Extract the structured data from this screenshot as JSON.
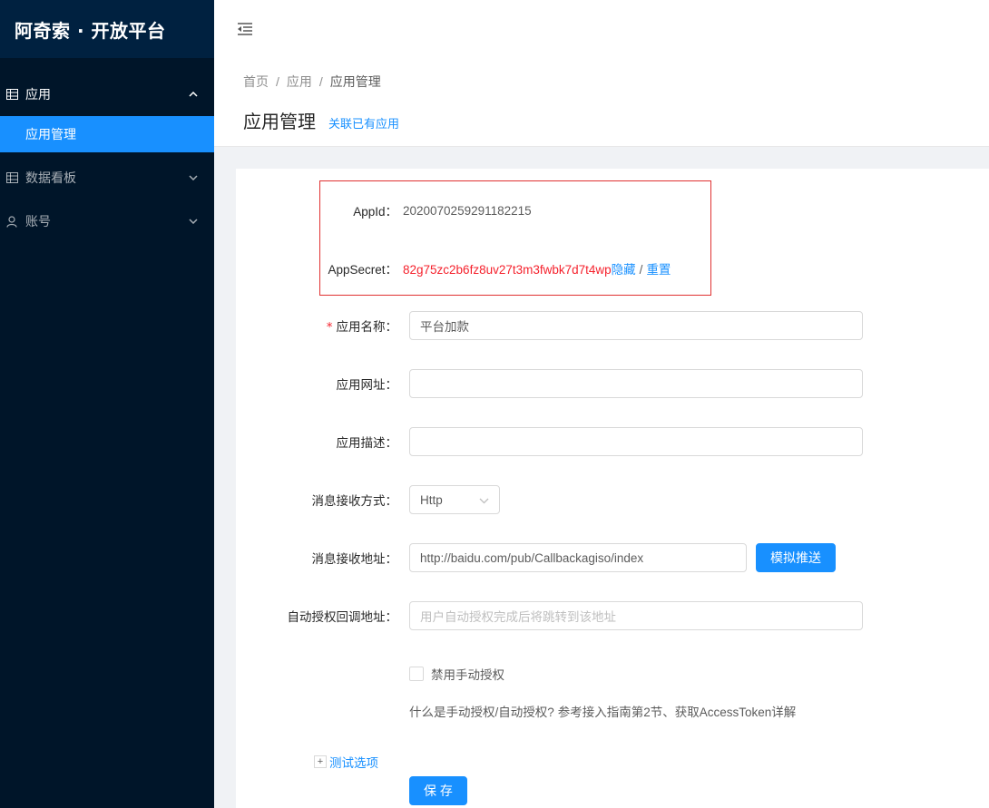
{
  "app": {
    "title": "阿奇索 · 开放平台"
  },
  "sidebar": {
    "items": [
      {
        "label": "应用",
        "icon": "table-icon",
        "expanded": true,
        "children": [
          {
            "label": "应用管理",
            "selected": true
          }
        ]
      },
      {
        "label": "数据看板",
        "icon": "table-icon",
        "expanded": false
      },
      {
        "label": "账号",
        "icon": "user-icon",
        "expanded": false
      }
    ]
  },
  "header": {
    "trigger_icon": "menu-fold-icon"
  },
  "breadcrumb": [
    "首页",
    "应用",
    "应用管理"
  ],
  "breadcrumb_separator": "/",
  "page": {
    "title": "应用管理",
    "link": "关联已有应用"
  },
  "form": {
    "appid": {
      "label": "AppId",
      "value": "2020070259291182215"
    },
    "appsecret": {
      "label": "AppSecret",
      "value": "82g75zc2b6fz8uv27t3m3fwbk7d7t4wp",
      "hide": "隐藏",
      "separator": "/",
      "reset": "重置"
    },
    "colon": "：",
    "app_name": {
      "label": "应用名称",
      "required": true,
      "value": "平台加款"
    },
    "app_url": {
      "label": "应用网址",
      "value": ""
    },
    "app_desc": {
      "label": "应用描述",
      "value": ""
    },
    "msg_method": {
      "label": "消息接收方式",
      "value": "Http"
    },
    "msg_url": {
      "label": "消息接收地址",
      "value": "http://baidu.com/pub/Callbackagiso/index",
      "button": "模拟推送"
    },
    "auth_callback": {
      "label": "自动授权回调地址",
      "placeholder": "用户自动授权完成后将跳转到该地址"
    },
    "disable_manual": {
      "label": "禁用手动授权",
      "checked": false
    },
    "help": {
      "text": "什么是手动授权/自动授权?",
      "link": "参考接入指南第2节、获取AccessToken详解"
    },
    "test_options": {
      "label": "测试选项"
    },
    "save": {
      "label": "保 存"
    }
  },
  "colors": {
    "primary": "#1890ff",
    "sider": "#001529",
    "danger": "#f5222d"
  }
}
